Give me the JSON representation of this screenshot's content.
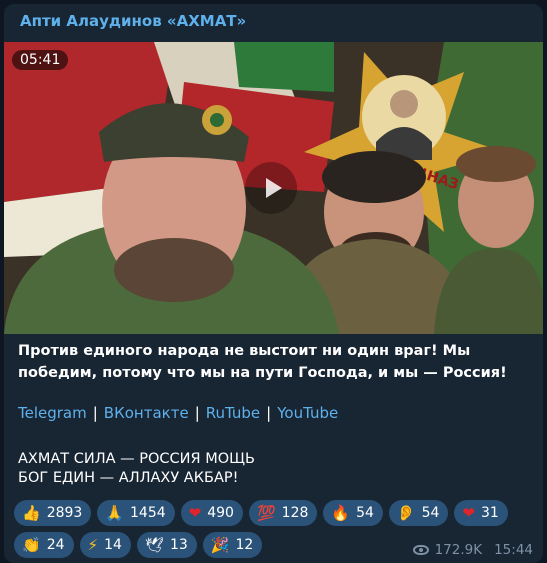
{
  "message": {
    "channel_name": "Апти Алаудинов «АХМАТ»",
    "video": {
      "duration": "05:41",
      "flag_text": "СПЕЦНАЗ"
    },
    "caption": "Против единого народа не выстоит ни один враг! Мы победим, потому что мы на пути Господа, и мы — Россия!",
    "links": [
      "Telegram",
      "ВКонтакте",
      "RuTube",
      "YouTube"
    ],
    "link_separator": "|",
    "slogans": [
      "АХМАТ СИЛА — РОССИЯ МОЩЬ",
      "БОГ ЕДИН — АЛЛАХУ АКБАР!"
    ],
    "reactions": [
      {
        "icon": "thumbs-up",
        "emoji": "👍",
        "count": "2893"
      },
      {
        "icon": "praying-hands",
        "emoji": "🙏",
        "count": "1454"
      },
      {
        "icon": "red-heart",
        "emoji": "❤",
        "count": "490"
      },
      {
        "icon": "hundred-points",
        "emoji": "💯",
        "count": "128"
      },
      {
        "icon": "fire",
        "emoji": "🔥",
        "count": "54"
      },
      {
        "icon": "ear",
        "emoji": "👂",
        "count": "54"
      },
      {
        "icon": "heart-on-fire",
        "emoji": "❤",
        "count": "31"
      },
      {
        "icon": "clapping-hands",
        "emoji": "👏",
        "count": "24"
      },
      {
        "icon": "high-voltage",
        "emoji": "⚡",
        "count": "14"
      },
      {
        "icon": "dove",
        "emoji": "🕊",
        "count": "13"
      },
      {
        "icon": "party-popper",
        "emoji": "🎉",
        "count": "12"
      }
    ],
    "views": "172.9K",
    "time": "15:44"
  },
  "colors": {
    "background": "#0e1621",
    "bubble": "#182533",
    "accent": "#5fb1ec",
    "reaction_pill": "#2b5278",
    "meta": "#7f91a4"
  }
}
